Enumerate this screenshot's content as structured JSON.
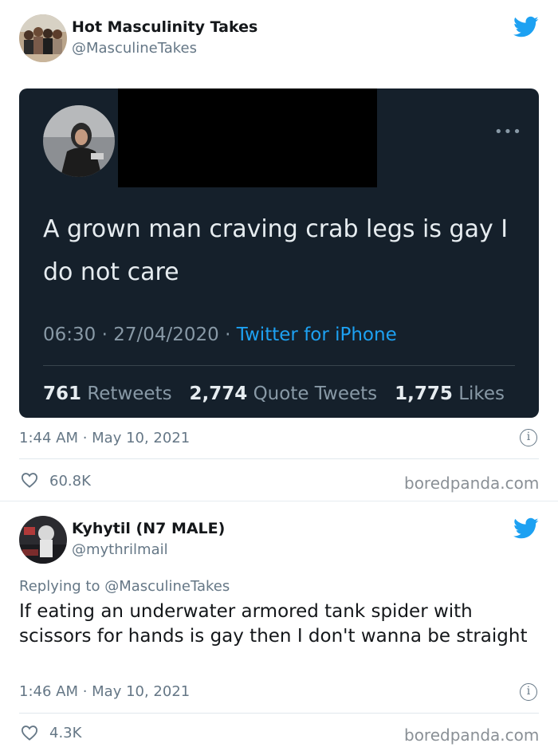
{
  "tweet1": {
    "name": "Hot Masculinity Takes",
    "handle": "@MasculineTakes",
    "embedded": {
      "text": "A grown man craving crab legs is gay I do not care",
      "time": "06:30",
      "date": "27/04/2020",
      "source": "Twitter for iPhone",
      "retweets": "761",
      "retweets_label": "Retweets",
      "quotes": "2,774",
      "quotes_label": "Quote Tweets",
      "likes": "1,775",
      "likes_label": "Likes"
    },
    "timestamp": "1:44 AM · May 10, 2021",
    "like_count": "60.8K",
    "credit": "boredpanda.com"
  },
  "tweet2": {
    "name": "Kyhytil (N7 MALE)",
    "handle": "@mythrilmail",
    "replying_prefix": "Replying to",
    "replying_to": "@MasculineTakes",
    "text": "If eating an underwater armored tank spider with scissors for hands is gay then I don't wanna be straight",
    "timestamp": "1:46 AM · May 10, 2021",
    "like_count": "4.3K",
    "credit": "boredpanda.com"
  },
  "colors": {
    "twitter_blue": "#1da1f2",
    "dim_background": "#15202b",
    "text": "#14171a",
    "secondary": "#657786"
  },
  "icons": [
    "twitter-bird-icon",
    "more-icon",
    "info-icon",
    "heart-icon"
  ]
}
